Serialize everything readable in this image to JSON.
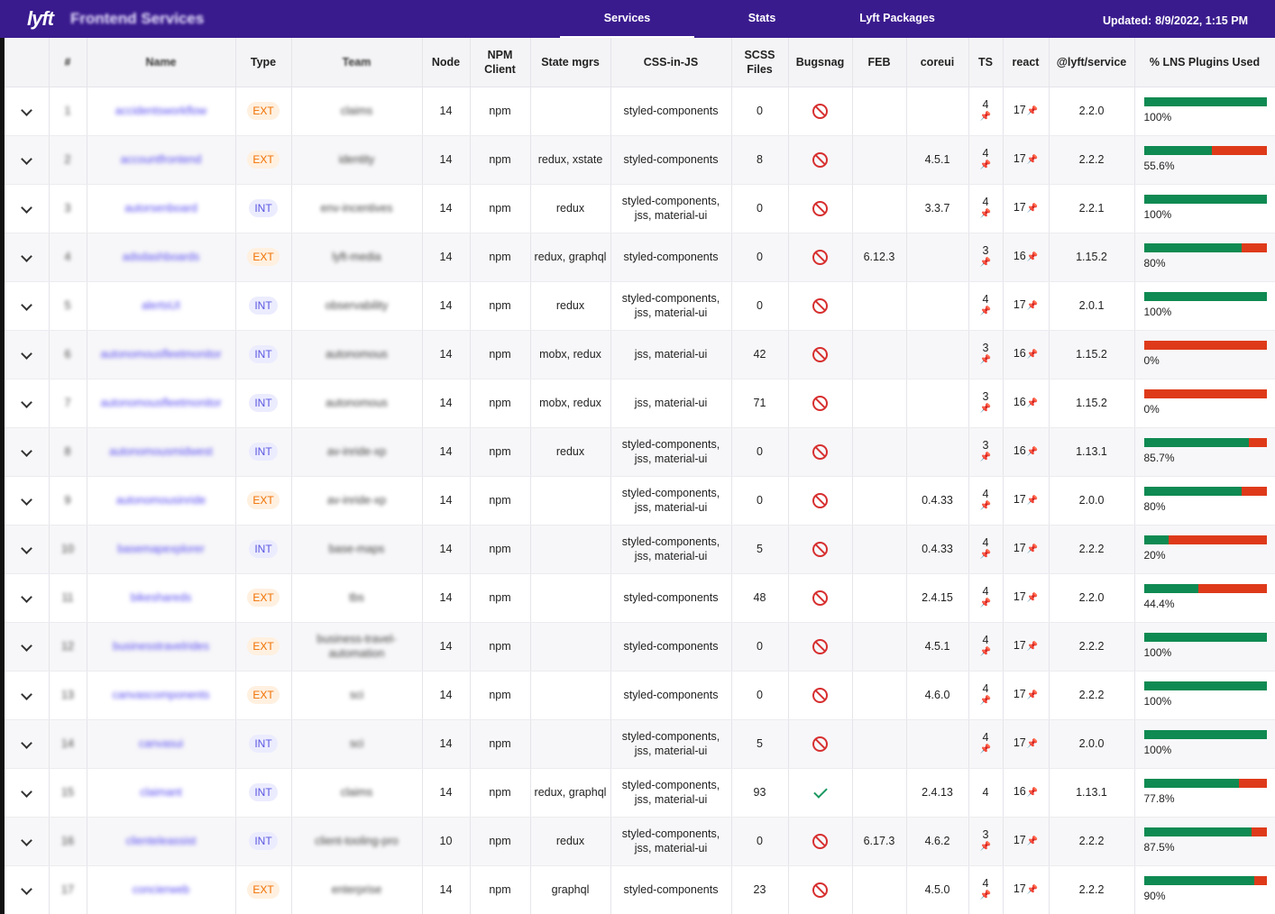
{
  "header": {
    "logo": "lyft",
    "title": "Frontend Services",
    "tabs": [
      {
        "label": "Services",
        "active": true
      },
      {
        "label": "Stats",
        "active": false
      },
      {
        "label": "Lyft Packages",
        "active": false
      }
    ],
    "updated_label": "Updated:",
    "updated_value": "8/9/2022, 1:15 PM"
  },
  "columns": [
    "",
    "#",
    "Name",
    "Type",
    "Team",
    "Node",
    "NPM Client",
    "State mgrs",
    "CSS-in-JS",
    "SCSS Files",
    "Bugsnag",
    "FEB",
    "coreui",
    "TS",
    "react",
    "@lyft/service",
    "% LNS Plugins Used"
  ],
  "colors": {
    "accent": "#3a1b8e",
    "ext": "#f07000",
    "int": "#5a57e0",
    "ok": "#0f8a52",
    "bad": "#de3a1a"
  },
  "rows": [
    {
      "num": "1",
      "name": "accidentsworkflow",
      "type": "EXT",
      "team": "claims",
      "node": "14",
      "npm": "npm",
      "state": "",
      "css": "styled-components",
      "scss": "0",
      "bugsnag": "no",
      "feb": "",
      "coreui": "",
      "ts": "4",
      "ts_pin": true,
      "react": "17",
      "service": "2.2.0",
      "lns": 100,
      "lns_label": "100%"
    },
    {
      "num": "2",
      "name": "accountfrontend",
      "type": "EXT",
      "team": "identity",
      "node": "14",
      "npm": "npm",
      "state": "redux, xstate",
      "css": "styled-components",
      "scss": "8",
      "bugsnag": "no",
      "feb": "",
      "coreui": "4.5.1",
      "ts": "4",
      "ts_pin": true,
      "react": "17",
      "service": "2.2.2",
      "lns": 55.6,
      "lns_label": "55.6%"
    },
    {
      "num": "3",
      "name": "autorsenboard",
      "type": "INT",
      "team": "env-incentives",
      "node": "14",
      "npm": "npm",
      "state": "redux",
      "css": "styled-components, jss, material-ui",
      "scss": "0",
      "bugsnag": "no",
      "feb": "",
      "coreui": "3.3.7",
      "ts": "4",
      "ts_pin": true,
      "react": "17",
      "service": "2.2.1",
      "lns": 100,
      "lns_label": "100%"
    },
    {
      "num": "4",
      "name": "adsdashboards",
      "type": "EXT",
      "team": "lyft-media",
      "node": "14",
      "npm": "npm",
      "state": "redux, graphql",
      "css": "styled-components",
      "scss": "0",
      "bugsnag": "no",
      "feb": "6.12.3",
      "coreui": "",
      "ts": "3",
      "ts_pin": true,
      "react": "16",
      "service": "1.15.2",
      "lns": 80,
      "lns_label": "80%"
    },
    {
      "num": "5",
      "name": "alertsUI",
      "type": "INT",
      "team": "observability",
      "node": "14",
      "npm": "npm",
      "state": "redux",
      "css": "styled-components, jss, material-ui",
      "scss": "0",
      "bugsnag": "no",
      "feb": "",
      "coreui": "",
      "ts": "4",
      "ts_pin": true,
      "react": "17",
      "service": "2.0.1",
      "lns": 100,
      "lns_label": "100%"
    },
    {
      "num": "6",
      "name": "autonomousfleetmonitor",
      "type": "INT",
      "team": "autonomous",
      "node": "14",
      "npm": "npm",
      "state": "mobx, redux",
      "css": "jss, material-ui",
      "scss": "42",
      "bugsnag": "no",
      "feb": "",
      "coreui": "",
      "ts": "3",
      "ts_pin": true,
      "react": "16",
      "service": "1.15.2",
      "lns": 0,
      "lns_label": "0%"
    },
    {
      "num": "7",
      "name": "autonomousfleetmonitor",
      "type": "INT",
      "team": "autonomous",
      "node": "14",
      "npm": "npm",
      "state": "mobx, redux",
      "css": "jss, material-ui",
      "scss": "71",
      "bugsnag": "no",
      "feb": "",
      "coreui": "",
      "ts": "3",
      "ts_pin": true,
      "react": "16",
      "service": "1.15.2",
      "lns": 0,
      "lns_label": "0%"
    },
    {
      "num": "8",
      "name": "autonomousmidwest",
      "type": "INT",
      "team": "av-inride-xp",
      "node": "14",
      "npm": "npm",
      "state": "redux",
      "css": "styled-components, jss, material-ui",
      "scss": "0",
      "bugsnag": "no",
      "feb": "",
      "coreui": "",
      "ts": "3",
      "ts_pin": true,
      "react": "16",
      "service": "1.13.1",
      "lns": 85.7,
      "lns_label": "85.7%"
    },
    {
      "num": "9",
      "name": "autonomousinride",
      "type": "EXT",
      "team": "av-inride-xp",
      "node": "14",
      "npm": "npm",
      "state": "",
      "css": "styled-components, jss, material-ui",
      "scss": "0",
      "bugsnag": "no",
      "feb": "",
      "coreui": "0.4.33",
      "ts": "4",
      "ts_pin": true,
      "react": "17",
      "service": "2.0.0",
      "lns": 80,
      "lns_label": "80%"
    },
    {
      "num": "10",
      "name": "basemapexplorer",
      "type": "INT",
      "team": "base-maps",
      "node": "14",
      "npm": "npm",
      "state": "",
      "css": "styled-components, jss, material-ui",
      "scss": "5",
      "bugsnag": "no",
      "feb": "",
      "coreui": "0.4.33",
      "ts": "4",
      "ts_pin": true,
      "react": "17",
      "service": "2.2.2",
      "lns": 20,
      "lns_label": "20%"
    },
    {
      "num": "11",
      "name": "bikeshareds",
      "type": "EXT",
      "team": "tbs",
      "node": "14",
      "npm": "npm",
      "state": "",
      "css": "styled-components",
      "scss": "48",
      "bugsnag": "no",
      "feb": "",
      "coreui": "2.4.15",
      "ts": "4",
      "ts_pin": true,
      "react": "17",
      "service": "2.2.0",
      "lns": 44.4,
      "lns_label": "44.4%"
    },
    {
      "num": "12",
      "name": "businesstravelrides",
      "type": "EXT",
      "team": "business-travel-automation",
      "node": "14",
      "npm": "npm",
      "state": "",
      "css": "styled-components",
      "scss": "0",
      "bugsnag": "no",
      "feb": "",
      "coreui": "4.5.1",
      "ts": "4",
      "ts_pin": true,
      "react": "17",
      "service": "2.2.2",
      "lns": 100,
      "lns_label": "100%"
    },
    {
      "num": "13",
      "name": "canvascomponents",
      "type": "EXT",
      "team": "sci",
      "node": "14",
      "npm": "npm",
      "state": "",
      "css": "styled-components",
      "scss": "0",
      "bugsnag": "no",
      "feb": "",
      "coreui": "4.6.0",
      "ts": "4",
      "ts_pin": true,
      "react": "17",
      "service": "2.2.2",
      "lns": 100,
      "lns_label": "100%"
    },
    {
      "num": "14",
      "name": "canvasui",
      "type": "INT",
      "team": "sci",
      "node": "14",
      "npm": "npm",
      "state": "",
      "css": "styled-components, jss, material-ui",
      "scss": "5",
      "bugsnag": "no",
      "feb": "",
      "coreui": "",
      "ts": "4",
      "ts_pin": true,
      "react": "17",
      "service": "2.0.0",
      "lns": 100,
      "lns_label": "100%"
    },
    {
      "num": "15",
      "name": "claimant",
      "type": "INT",
      "team": "claims",
      "node": "14",
      "npm": "npm",
      "state": "redux, graphql",
      "css": "styled-components, jss, material-ui",
      "scss": "93",
      "bugsnag": "yes",
      "feb": "",
      "coreui": "2.4.13",
      "ts": "4",
      "ts_pin": false,
      "react": "16",
      "service": "1.13.1",
      "lns": 77.8,
      "lns_label": "77.8%"
    },
    {
      "num": "16",
      "name": "clienteleassist",
      "type": "INT",
      "team": "client-tooling-pro",
      "node": "10",
      "npm": "npm",
      "state": "redux",
      "css": "styled-components, jss, material-ui",
      "scss": "0",
      "bugsnag": "no",
      "feb": "6.17.3",
      "coreui": "4.6.2",
      "ts": "3",
      "ts_pin": true,
      "react": "17",
      "service": "2.2.2",
      "lns": 87.5,
      "lns_label": "87.5%"
    },
    {
      "num": "17",
      "name": "concierweb",
      "type": "EXT",
      "team": "enterprise",
      "node": "14",
      "npm": "npm",
      "state": "graphql",
      "css": "styled-components",
      "scss": "23",
      "bugsnag": "no",
      "feb": "",
      "coreui": "4.5.0",
      "ts": "4",
      "ts_pin": true,
      "react": "17",
      "service": "2.2.2",
      "lns": 90,
      "lns_label": "90%"
    }
  ]
}
